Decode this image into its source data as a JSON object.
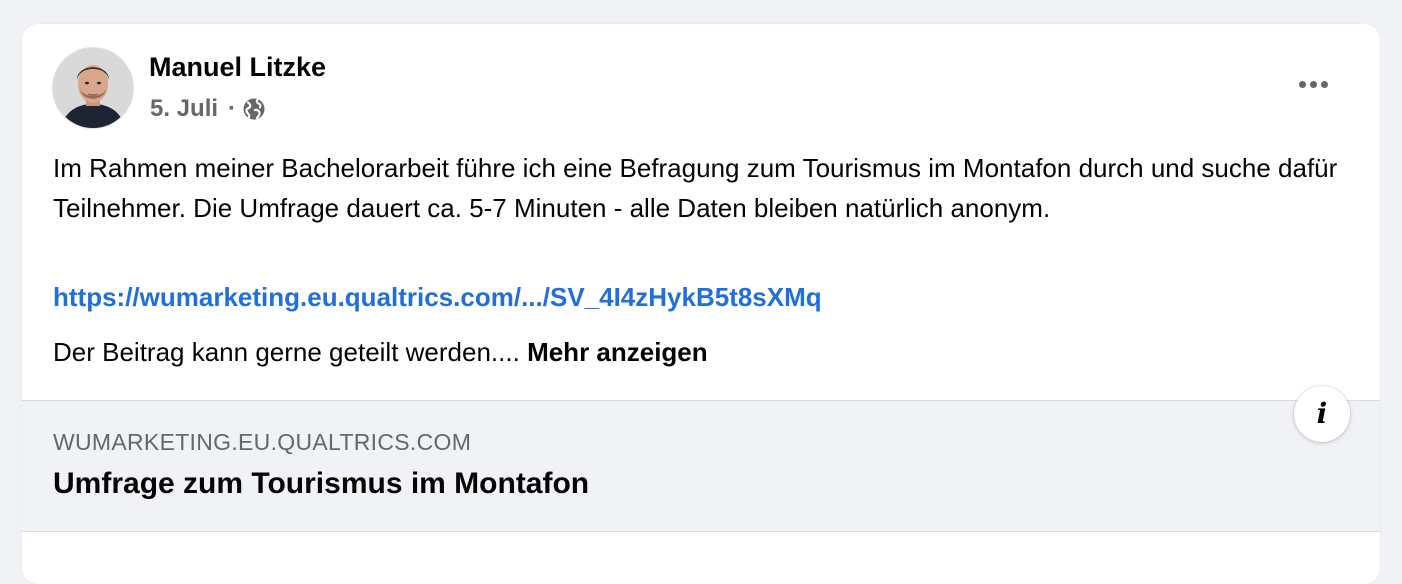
{
  "post": {
    "author": "Manuel Litzke",
    "date": "5. Juli",
    "separator": "·",
    "privacy_icon": "globe-icon",
    "menu_icon": "more-horizontal-icon",
    "text": "Im Rahmen meiner Bachelorarbeit führe ich eine Befragung zum Tourismus im Montafon durch und suche dafür Teilnehmer. Die Umfrage dauert ca. 5-7 Minuten - alle Daten bleiben natürlich anonym.",
    "link": "https://wumarketing.eu.qualtrics.com/.../SV_4I4zHykB5t8sXMq",
    "footer_text": "Der Beitrag kann gerne geteilt werden....",
    "see_more": "Mehr anzeigen"
  },
  "preview": {
    "domain": "WUMARKETING.EU.QUALTRICS.COM",
    "title": "Umfrage zum Tourismus im Montafon",
    "info_icon": "info-icon",
    "info_glyph": "i"
  },
  "colors": {
    "link": "#216fdb",
    "secondary_text": "#65676b",
    "primary_text": "#050505",
    "preview_background": "#f0f2f5",
    "card_background": "#ffffff"
  }
}
